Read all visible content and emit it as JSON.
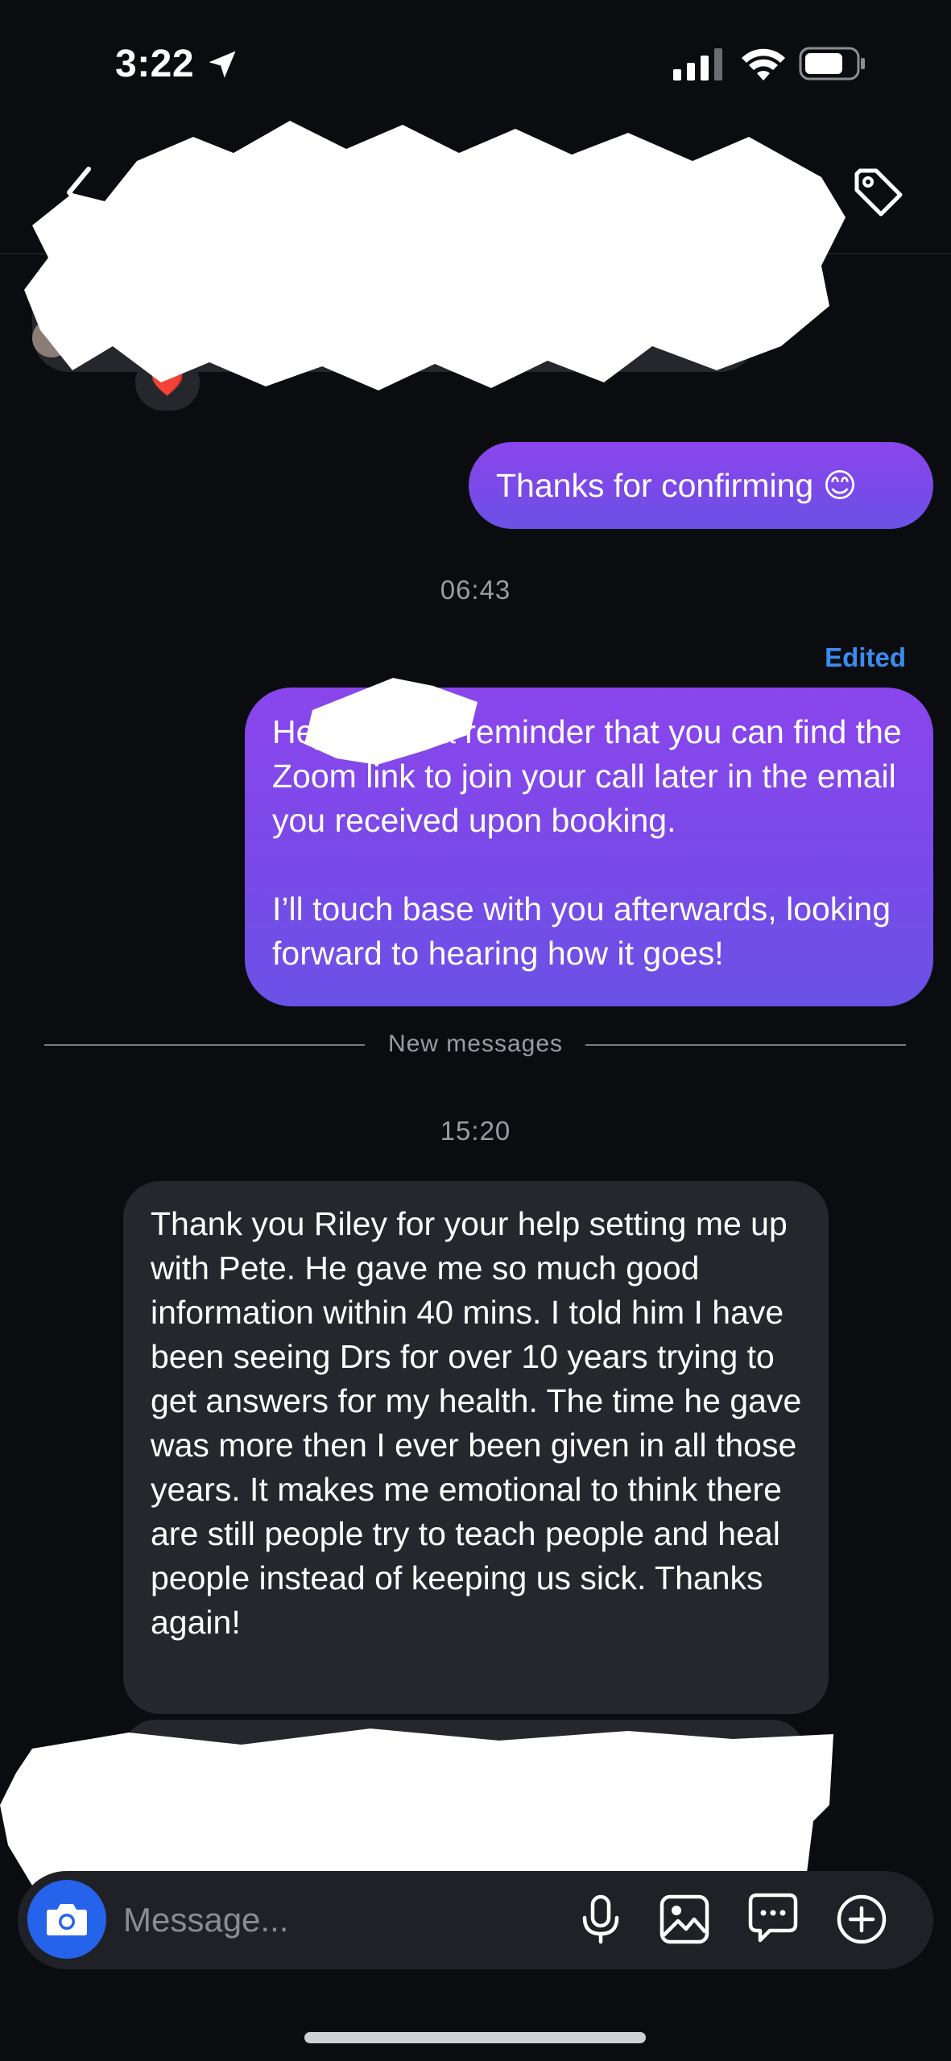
{
  "status_bar": {
    "time": "3:22"
  },
  "thread": {
    "outgoing_1": "Thanks for confirming 😊",
    "timestamp_1": "06:43",
    "edited_label": "Edited",
    "outgoing_2": {
      "paragraph_1": "Hey ... just a reminder that you can find the Zoom link to join your call later in the email you received upon booking.",
      "paragraph_2": "I’ll touch base with you afterwards, looking forward to hearing how it goes!"
    },
    "new_messages_label": "New messages",
    "timestamp_2": "15:20",
    "incoming_1": "Thank you Riley for your help setting me up with Pete. He gave me so much good information within 40 mins. I told him I have been seeing Drs for over 10 years trying to get answers for my health. The time he gave was more then I ever been given in all those years. It makes me emotional to think there are still people try to teach people and heal people instead of keeping us sick. Thanks again!",
    "reaction": "❤️"
  },
  "composer": {
    "placeholder": "Message..."
  },
  "colors": {
    "background": "#0b0c10",
    "outgoing_bubble": "#7f48ea",
    "incoming_bubble": "#25272c",
    "edited_label": "#3a8df0",
    "camera_button": "#2563eb"
  },
  "icons": [
    "location-arrow-icon",
    "signal-icon",
    "wifi-icon",
    "battery-icon",
    "back-chevron-icon",
    "tag-icon",
    "camera-icon",
    "microphone-icon",
    "gallery-icon",
    "sticker-icon",
    "plus-circle-icon"
  ]
}
